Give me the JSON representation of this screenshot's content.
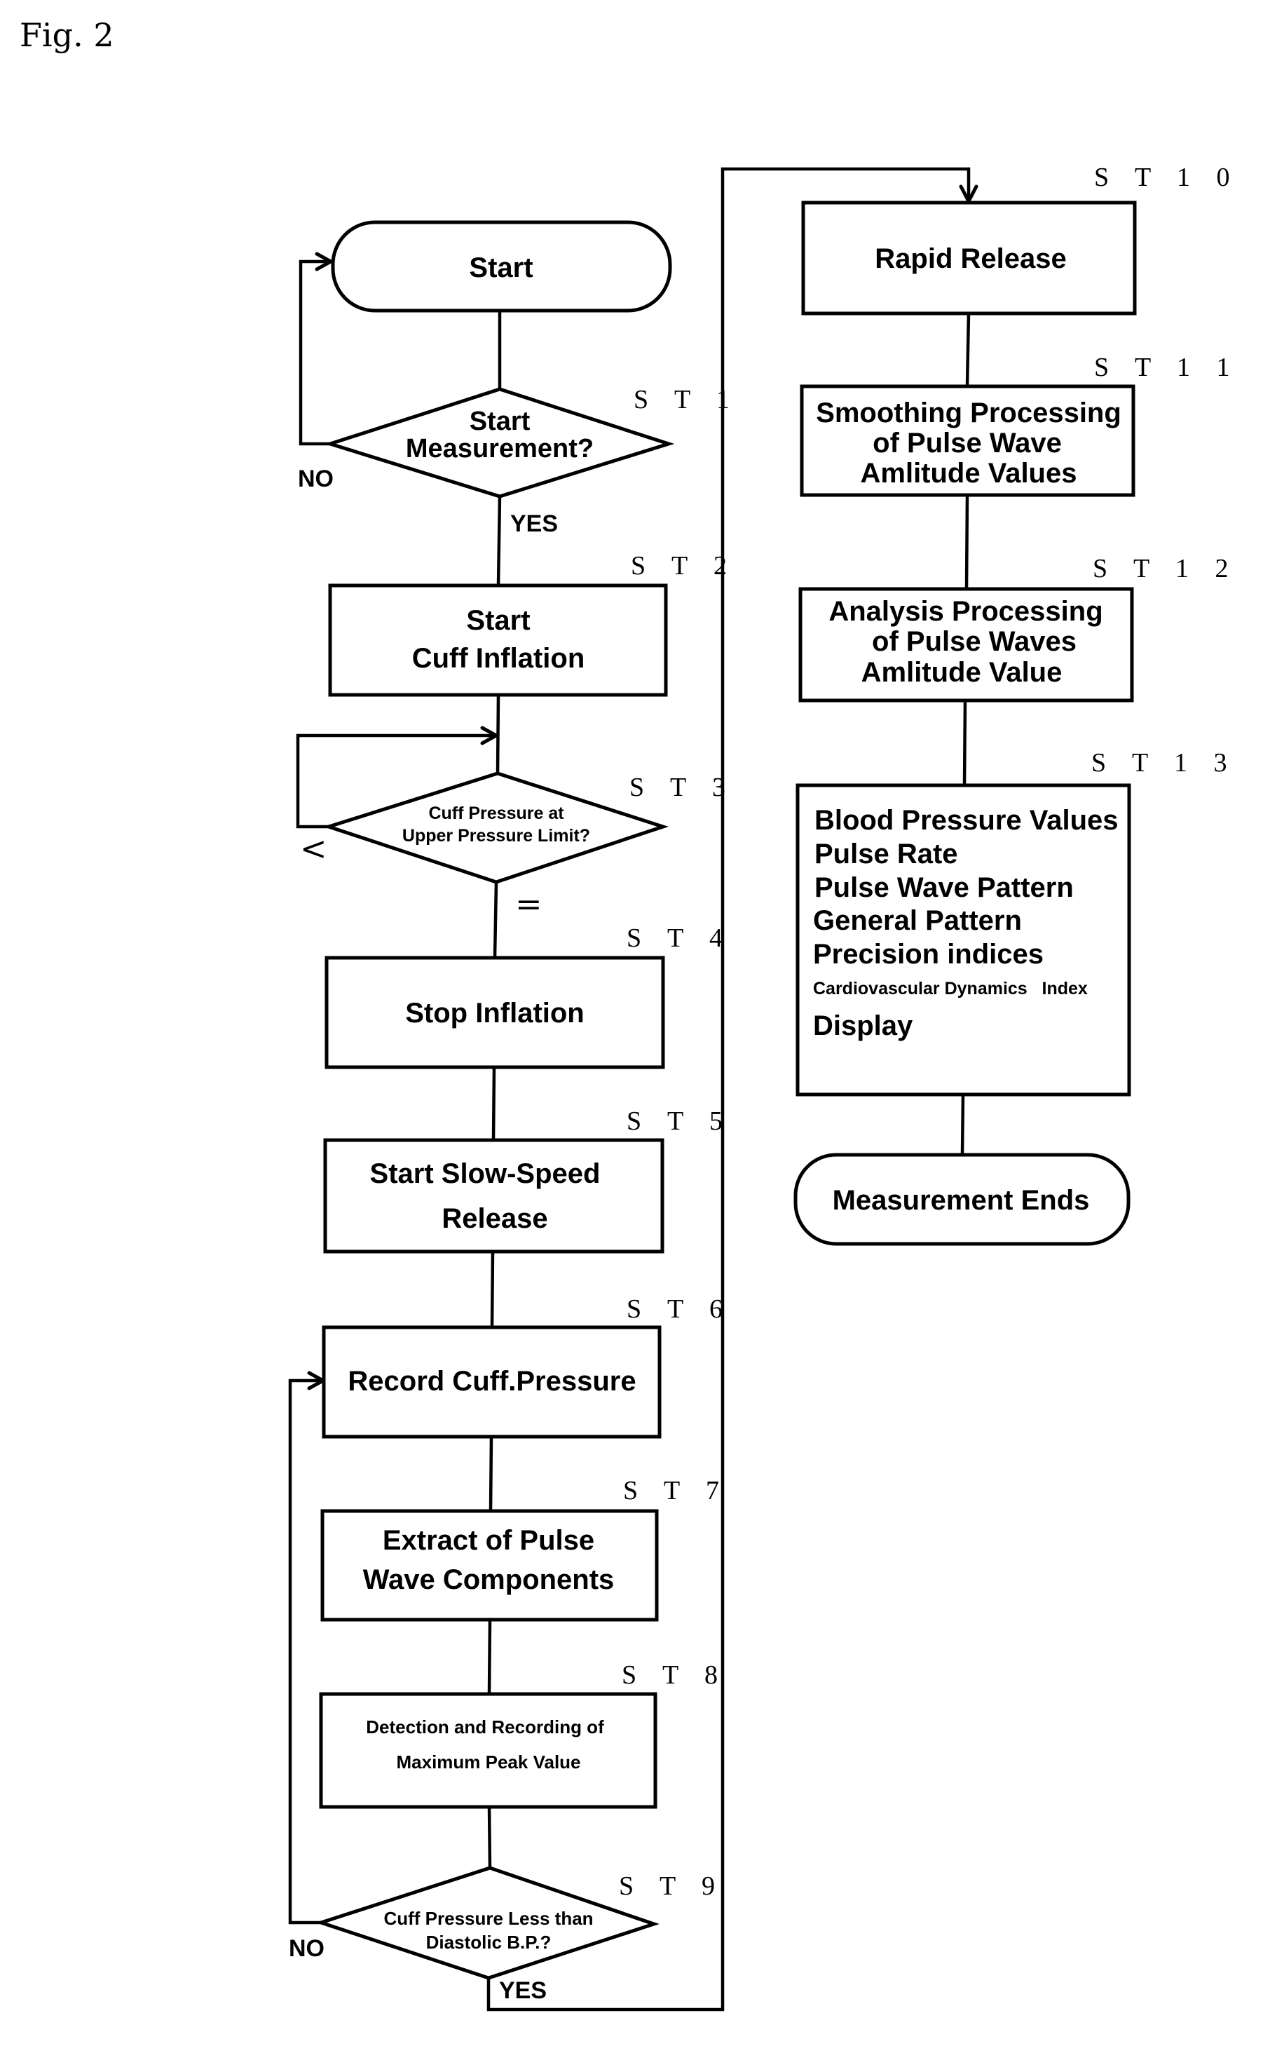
{
  "figure": {
    "title": "Fig. 2",
    "type": "flowchart"
  },
  "steps": {
    "start": {
      "label": "Start"
    },
    "st1": {
      "id": "ST1",
      "step_label": "S T 1",
      "lines": [
        "Start",
        "Measurement?"
      ],
      "kind": "decision",
      "yes": "YES",
      "no": "NO"
    },
    "st2": {
      "id": "ST2",
      "step_label": "S T 2",
      "lines": [
        "Start",
        "Cuff Inflation"
      ],
      "kind": "process"
    },
    "st3": {
      "id": "ST3",
      "step_label": "S T 3",
      "lines": [
        "Cuff Pressure at",
        "Upper Pressure Limit?"
      ],
      "kind": "decision",
      "less": "<",
      "equal": "="
    },
    "st4": {
      "id": "ST4",
      "step_label": "S T 4",
      "lines": [
        "Stop Inflation"
      ],
      "kind": "process"
    },
    "st5": {
      "id": "ST5",
      "step_label": "S T 5",
      "lines": [
        "Start Slow-Speed",
        "Release"
      ],
      "kind": "process"
    },
    "st6": {
      "id": "ST6",
      "step_label": "S T 6",
      "lines": [
        "Record Cuff.Pressure"
      ],
      "kind": "process"
    },
    "st7": {
      "id": "ST7",
      "step_label": "S T 7",
      "lines": [
        "Extract of Pulse",
        "Wave Components"
      ],
      "kind": "process"
    },
    "st8": {
      "id": "ST8",
      "step_label": "S T 8",
      "lines": [
        "Detection and Recording of",
        "Maximum Peak Value"
      ],
      "kind": "process"
    },
    "st9": {
      "id": "ST9",
      "step_label": "S T 9",
      "lines": [
        "Cuff Pressure Less than",
        "Diastolic B.P.?"
      ],
      "kind": "decision",
      "yes": "YES",
      "no": "NO"
    },
    "st10": {
      "id": "ST10",
      "step_label": "S T 1 0",
      "lines": [
        "Rapid Release"
      ],
      "kind": "process"
    },
    "st11": {
      "id": "ST11",
      "step_label": "S T 1 1",
      "lines": [
        "Smoothing Processing",
        "of Pulse Wave",
        "Amlitude Values"
      ],
      "kind": "process"
    },
    "st12": {
      "id": "ST12",
      "step_label": "S T 1 2",
      "lines": [
        "Analysis Processing",
        "of Pulse Waves",
        "Amlitude Value"
      ],
      "kind": "process"
    },
    "st13": {
      "id": "ST13",
      "step_label": "S T 1 3",
      "lines": [
        "Blood Pressure Values",
        "Pulse Rate",
        "Pulse Wave Pattern",
        "General Pattern",
        "Precision indices",
        "Cardiovascular Dynamics   Index",
        "Display"
      ],
      "kind": "process"
    },
    "end": {
      "label": "Measurement Ends"
    }
  }
}
